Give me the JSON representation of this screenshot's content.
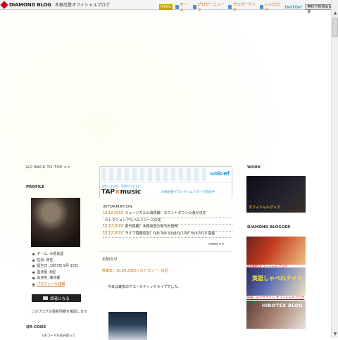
{
  "topbar": {
    "logo_text": "DIAMOND BLOG",
    "site_name": "木根尚登オフィシャルブログ",
    "menu_label": "MENU",
    "nav": [
      {
        "label": "ホーム",
        "icon": "home-icon"
      },
      {
        "label": "ブロガーニュース",
        "icon": "news-icon"
      },
      {
        "label": "ブロガーグッズ",
        "icon": "goods-icon"
      },
      {
        "label": "レシピログ",
        "icon": "recipe-icon"
      }
    ],
    "twitter_label": "twitter",
    "register_label": "無料で新規会員登録"
  },
  "left": {
    "go_top": "GO BACK TO TOP  >>",
    "profile_heading": "PROFILE",
    "profile_items": [
      "ネーム: 木根尚登",
      "性別: 男性",
      "誕生日: 1957年 9月 15日",
      "血液型: B型",
      "出身地: 東京都"
    ],
    "profile_link": "プロフィール詳細",
    "reader_button": "読者になる",
    "description": "このブログの最新情報を確認します",
    "qr_heading": "QR-CODE",
    "qr_caption": "QRコードを読み取って"
  },
  "center": {
    "banner": {
      "tagline": "きれいな水を、世界の子どもに",
      "title_a": "TAP",
      "title_x": "×",
      "title_b": "music",
      "sub": "木根尚登ゲストクリエイターで参加中",
      "brand": "unicef"
    },
    "info_heading": "INFORMATION",
    "info_items": [
      {
        "date": "10.12.2010",
        "text": "ミュージカル公演情報！カウントダウン公演が決定"
      },
      {
        "date": "",
        "text": "セレクションアルバムリリース決定"
      },
      {
        "date": "10.12.2010",
        "text": "新刊情報！木根尚登の新刊が発売"
      },
      {
        "date": "10.12.2010",
        "text": "ライブ情報追加！talk like singing LIVE tour2010 開催"
      }
    ],
    "info_more": "more  >>",
    "post": {
      "title": "お知らせ",
      "meta": "投稿日：10.20.2010 | カテゴリー：日記",
      "body": "今日は東京のアコースティックライブでした。"
    }
  },
  "right": {
    "work_heading": "WORK",
    "work_caption": "オフィシャルグッズ",
    "blogger_heading": "DIAMOND BLOGGER",
    "bloggers": [
      {
        "caption": "森田健作オフィシャルブログ",
        "overlay": ""
      },
      {
        "caption": "英語しゃべれナイト オフィシャルブログ",
        "overlay": "英語しゃべれナイト"
      },
      {
        "caption": "HIROTEX BLOG",
        "overlay": "HIROTEX BLOG"
      }
    ]
  }
}
